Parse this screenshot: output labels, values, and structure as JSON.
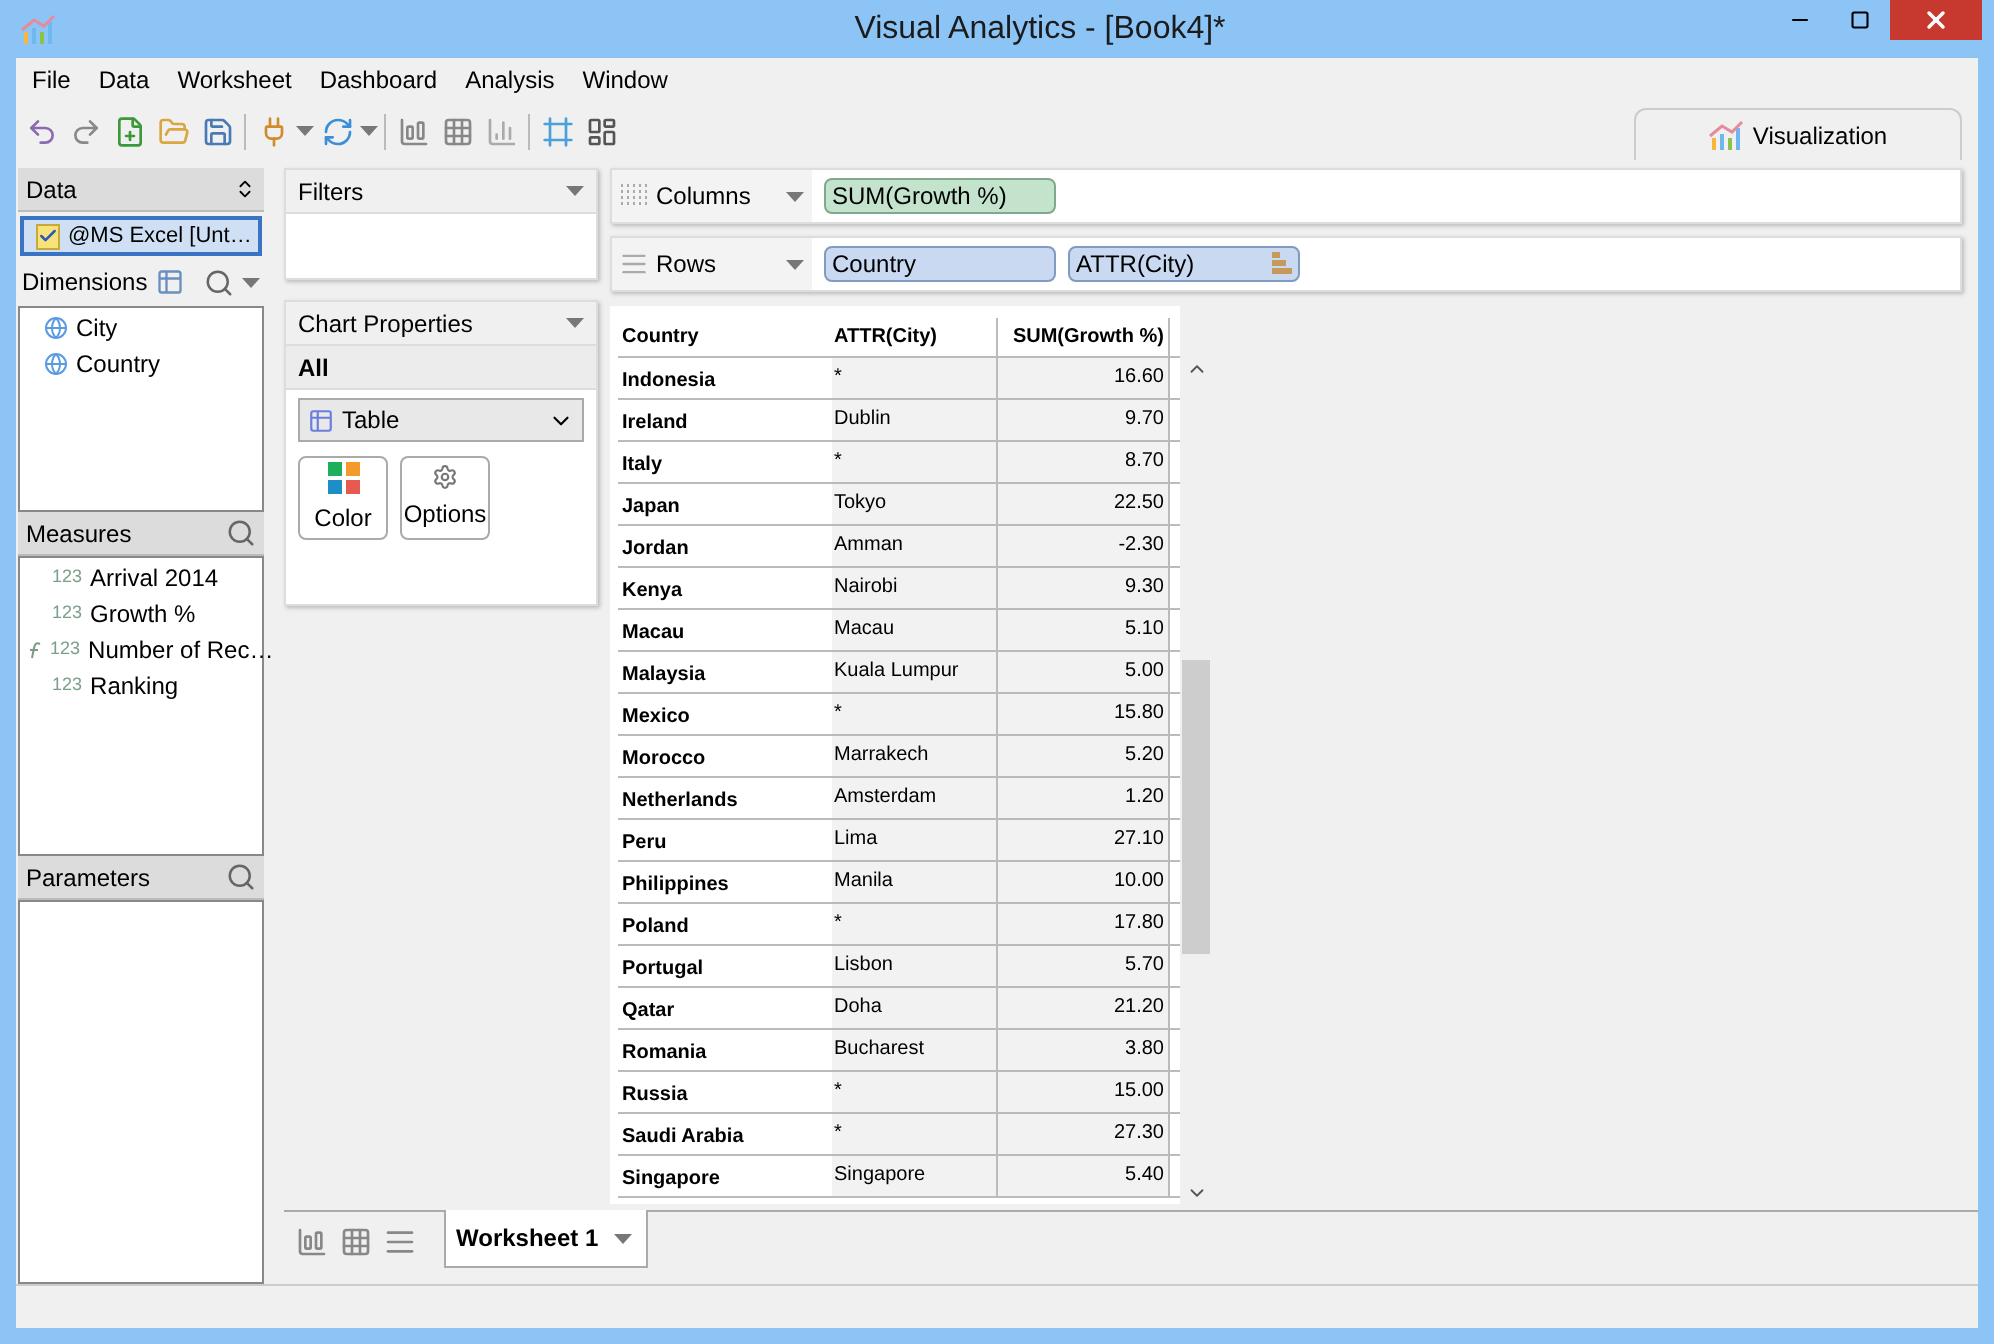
{
  "window": {
    "title": "Visual Analytics - [Book4]*"
  },
  "menu": [
    "File",
    "Data",
    "Worksheet",
    "Dashboard",
    "Analysis",
    "Window"
  ],
  "view_tabs": [
    {
      "label": "Visualization",
      "selected": true
    }
  ],
  "data_panel": {
    "title": "Data",
    "source": {
      "label": "@MS Excel [Unt…",
      "checked": true
    }
  },
  "dimensions": {
    "title": "Dimensions",
    "items": [
      "City",
      "Country"
    ]
  },
  "measures": {
    "title": "Measures",
    "items": [
      {
        "kind": "field",
        "type_label": "123",
        "name": "Arrival 2014"
      },
      {
        "kind": "field",
        "type_label": "123",
        "name": "Growth %"
      },
      {
        "kind": "calculated",
        "type_label": "123",
        "name": "Number of Rec…"
      },
      {
        "kind": "field",
        "type_label": "123",
        "name": "Ranking"
      }
    ]
  },
  "parameters": {
    "title": "Parameters"
  },
  "filters": {
    "title": "Filters"
  },
  "chart_properties": {
    "title": "Chart Properties",
    "section": "All",
    "chart_type": "Table",
    "buttons": [
      {
        "kind": "color",
        "label": "Color"
      },
      {
        "kind": "options",
        "label": "Options"
      }
    ]
  },
  "shelves": [
    {
      "label": "Columns",
      "kind": "columns",
      "pills": [
        {
          "text": "SUM(Growth %)",
          "kind": "measure",
          "sorted": false
        }
      ]
    },
    {
      "label": "Rows",
      "kind": "rows",
      "pills": [
        {
          "text": "Country",
          "kind": "dimension",
          "sorted": false
        },
        {
          "text": "ATTR(City)",
          "kind": "dimension",
          "sorted": true
        }
      ]
    }
  ],
  "table": {
    "columns": [
      "Country",
      "ATTR(City)",
      "SUM(Growth %)"
    ],
    "rows": [
      [
        "Indonesia",
        "*",
        "16.60"
      ],
      [
        "Ireland",
        "Dublin",
        "9.70"
      ],
      [
        "Italy",
        "*",
        "8.70"
      ],
      [
        "Japan",
        "Tokyo",
        "22.50"
      ],
      [
        "Jordan",
        "Amman",
        "-2.30"
      ],
      [
        "Kenya",
        "Nairobi",
        "9.30"
      ],
      [
        "Macau",
        "Macau",
        "5.10"
      ],
      [
        "Malaysia",
        "Kuala Lumpur",
        "5.00"
      ],
      [
        "Mexico",
        "*",
        "15.80"
      ],
      [
        "Morocco",
        "Marrakech",
        "5.20"
      ],
      [
        "Netherlands",
        "Amsterdam",
        "1.20"
      ],
      [
        "Peru",
        "Lima",
        "27.10"
      ],
      [
        "Philippines",
        "Manila",
        "10.00"
      ],
      [
        "Poland",
        "*",
        "17.80"
      ],
      [
        "Portugal",
        "Lisbon",
        "5.70"
      ],
      [
        "Qatar",
        "Doha",
        "21.20"
      ],
      [
        "Romania",
        "Bucharest",
        "3.80"
      ],
      [
        "Russia",
        "*",
        "15.00"
      ],
      [
        "Saudi Arabia",
        "*",
        "27.30"
      ],
      [
        "Singapore",
        "Singapore",
        "5.40"
      ]
    ]
  },
  "sheet_tabs": [
    {
      "label": "Worksheet 1",
      "selected": true
    }
  ]
}
